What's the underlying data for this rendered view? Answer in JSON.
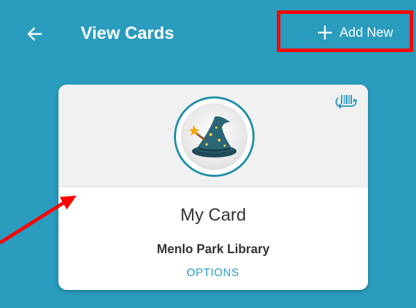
{
  "app_bar": {
    "title": "View Cards",
    "back_icon": "arrow-left-icon",
    "add_button": {
      "label": "Add New",
      "icon": "plus-icon"
    }
  },
  "card": {
    "name": "My Card",
    "library": "Menlo Park Library",
    "options_label": "OPTIONS",
    "avatar_icon": "wizard-hat-icon",
    "barcode_icon": "barcode-sync-icon"
  },
  "colors": {
    "background": "#2a9cbe",
    "card": "#ffffff",
    "annotation": "#ff0000",
    "avatar_border": "#1e8ea8"
  }
}
